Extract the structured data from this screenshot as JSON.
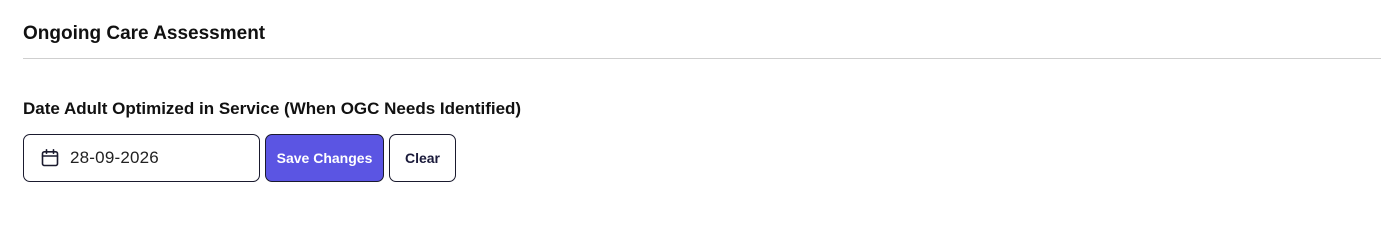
{
  "section": {
    "title": "Ongoing Care Assessment"
  },
  "field": {
    "label": "Date Adult Optimized in Service (When OGC Needs Identified)",
    "date_value": "28-09-2026",
    "icon": "calendar-icon"
  },
  "actions": {
    "save_label": "Save Changes",
    "clear_label": "Clear"
  },
  "colors": {
    "primary": "#5b55e3",
    "border": "#1a1a2e",
    "divider": "#cfcfcf"
  }
}
